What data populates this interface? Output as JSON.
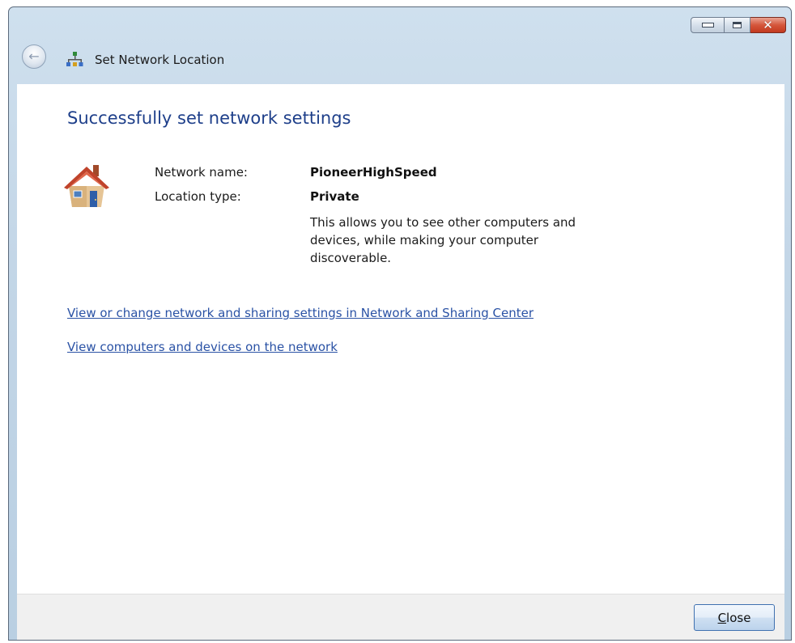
{
  "window": {
    "title": "Set Network Location",
    "caption": {
      "close_glyph": "✕"
    }
  },
  "back_button": {
    "glyph": "←"
  },
  "main": {
    "heading": "Successfully set network settings",
    "network_name_label": "Network name:",
    "network_name_value": "PioneerHighSpeed",
    "location_type_label": "Location type:",
    "location_type_value": "Private",
    "location_description": "This allows you to see other computers and devices, while making your computer discoverable.",
    "links": {
      "network_center": "View or change network and sharing settings in Network and Sharing Center",
      "view_computers": "View computers and devices on the network"
    }
  },
  "footer": {
    "close_accel": "C",
    "close_rest": "lose"
  },
  "colors": {
    "heading": "#1e3f8a",
    "link": "#2a52a5",
    "titlebar": "#c3d6e7"
  }
}
